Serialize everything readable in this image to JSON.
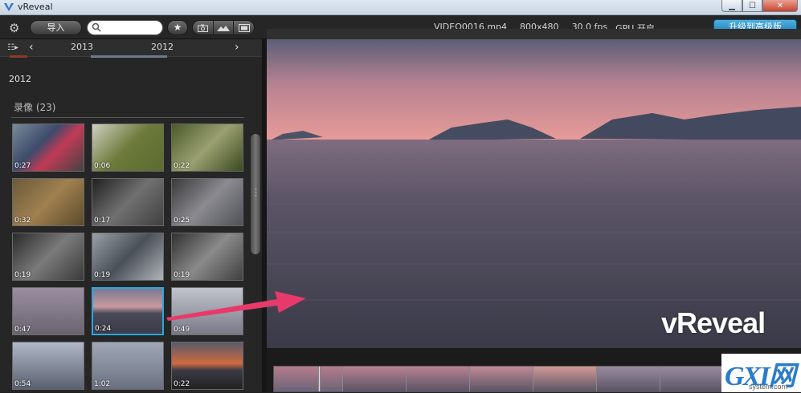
{
  "window": {
    "title": "vReveal",
    "min": "▁",
    "max": "☐",
    "close": "✕"
  },
  "toolbar": {
    "import_label": "导入",
    "search_placeholder": "",
    "star_glyph": "★",
    "filters": [
      "photo-icon",
      "panorama-icon",
      "video-icon"
    ]
  },
  "video_info": {
    "filename": "VIDEO0016.mp4",
    "resolution": "800x480",
    "fps": "30.0 fps",
    "gpu": "GPU 开启"
  },
  "upgrade_label": "升级到高级版",
  "timeline": {
    "prev": "‹",
    "next": "›",
    "year_left": "2013",
    "year_right": "2012"
  },
  "library": {
    "year": "2012",
    "section_title": "录像 (23)",
    "thumbnails": [
      {
        "duration": "0:27"
      },
      {
        "duration": "0:06"
      },
      {
        "duration": "0:22"
      },
      {
        "duration": "0:32"
      },
      {
        "duration": "0:17"
      },
      {
        "duration": "0:25"
      },
      {
        "duration": "0:19"
      },
      {
        "duration": "0:19"
      },
      {
        "duration": "0:19"
      },
      {
        "duration": "0:47"
      },
      {
        "duration": "0:24",
        "selected": true
      },
      {
        "duration": "0:49"
      },
      {
        "duration": "0:54"
      },
      {
        "duration": "1:02"
      },
      {
        "duration": "0:22"
      }
    ]
  },
  "player": {
    "watermark": "vReveal"
  },
  "site_badge": {
    "big": "GXI网",
    "small": "system.com"
  },
  "colors": {
    "accent": "#29a8e0",
    "upgrade": "#1c77b6",
    "arrow": "#e83a6a"
  }
}
